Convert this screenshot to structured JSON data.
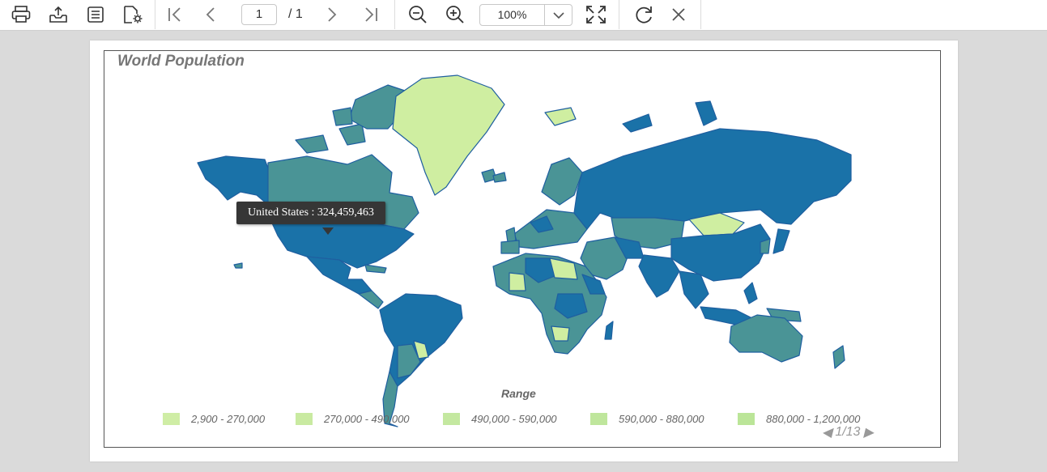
{
  "toolbar": {
    "page_current": "1",
    "page_total": "/ 1",
    "zoom": "100%"
  },
  "report": {
    "title": "World Population",
    "tooltip": "United States : 324,459,463",
    "legend_title": "Range",
    "legend_items": [
      {
        "label": "2,900 - 270,000",
        "color": "#cfeda5"
      },
      {
        "label": "270,000 - 490,000",
        "color": "#c9eaa1"
      },
      {
        "label": "490,000 - 590,000",
        "color": "#c4e8a0"
      },
      {
        "label": "590,000 - 880,000",
        "color": "#bfe69c"
      },
      {
        "label": "880,000 - 1,200,000",
        "color": "#bbe598"
      }
    ],
    "legend_pager": "1/13",
    "colors": {
      "dark_blue": "#1a72a8",
      "teal": "#4a9496",
      "light_green": "#cfeea1",
      "border": "#1f5fa0"
    }
  }
}
